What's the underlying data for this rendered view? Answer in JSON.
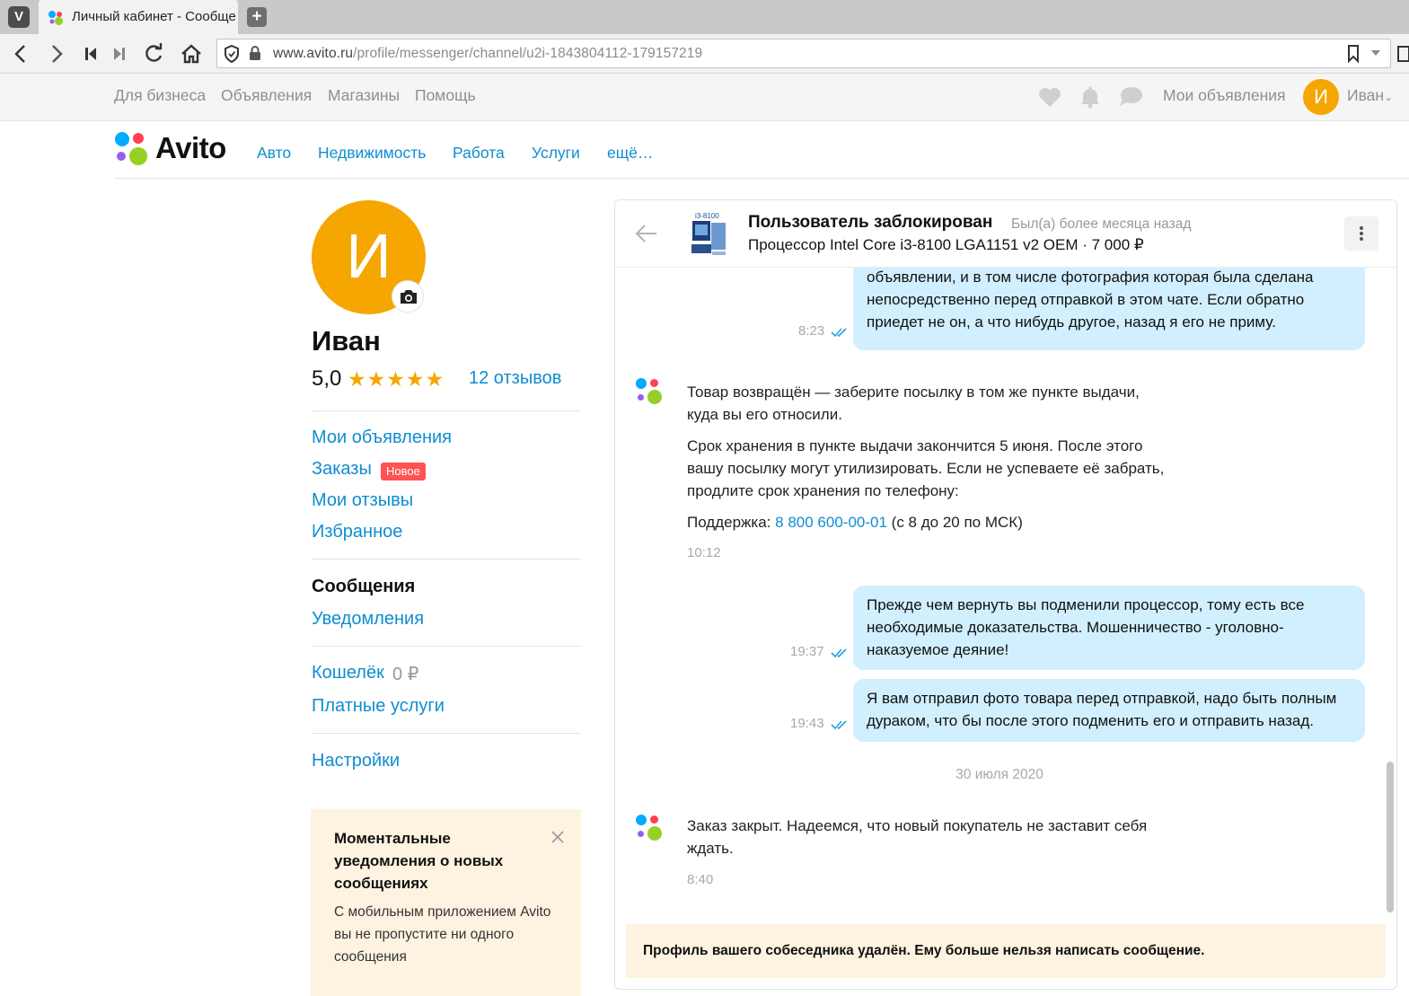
{
  "browser": {
    "tab_title": "Личный кабинет - Сообще",
    "url_domain": "www.avito.ru",
    "url_path": "/profile/messenger/channel/u2i-1843804112-179157219"
  },
  "topbar": {
    "links": [
      "Для бизнеса",
      "Объявления",
      "Магазины",
      "Помощь"
    ],
    "my_ads": "Мои объявления",
    "avatar_letter": "И",
    "username": "Иван"
  },
  "header": {
    "logo_text": "Avito",
    "categories": [
      "Авто",
      "Недвижимость",
      "Работа",
      "Услуги",
      "ещё…"
    ]
  },
  "profile": {
    "avatar_letter": "И",
    "name": "Иван",
    "rating": "5,0",
    "stars": 5,
    "reviews": "12 отзывов",
    "menu": {
      "my_ads": "Мои объявления",
      "orders": "Заказы",
      "orders_badge": "Новое",
      "my_reviews": "Мои отзывы",
      "favorites": "Избранное",
      "messages": "Сообщения",
      "notifications": "Уведомления",
      "wallet": "Кошелёк",
      "wallet_amount": "0 ₽",
      "paid_services": "Платные услуги",
      "settings": "Настройки"
    },
    "promo": {
      "title": "Моментальные уведомления о новых сообщениях",
      "text": "С мобильным приложением Avito вы не пропустите ни одного сообщения"
    }
  },
  "chat": {
    "user_status": "Пользователь заблокирован",
    "last_seen": "Был(а) более месяца назад",
    "item": "Процессор Intel Core i3-8100 LGA1151 v2 OEM · 7 000 ₽",
    "thumb_label": "i3-8100",
    "messages": [
      {
        "lines": [
          "объявлении, и в том числе фотография которая была сделана",
          "непосредственно перед отправкой в этом чате. Если обратно",
          "приедет не он, а что нибудь другое, назад я его не приму."
        ],
        "time": "8:23"
      },
      {
        "para1": [
          "Товар возвращён — заберите посылку в том же пункте выдачи,",
          "куда вы его относили."
        ],
        "para2": [
          "Срок хранения в пункте выдачи закончится 5 июня. После этого",
          "вашу посылку могут утилизировать. Если не успеваете её забрать,",
          "продлите срок хранения по телефону:"
        ],
        "support_label": "Поддержка:",
        "support_phone": "8 800 600-00-01",
        "support_hours": "(с 8 до 20 по МСК)",
        "time": "10:12"
      },
      {
        "lines": [
          "Прежде чем вернуть вы подменили процессор, тому есть все",
          "необходимые доказательства. Мошенничество - уголовно-",
          "наказуемое деяние!"
        ],
        "time": "19:37"
      },
      {
        "lines": [
          "Я вам отправил фото товара перед отправкой, надо быть полным",
          "дураком, что бы после этого подменить его и отправить назад."
        ],
        "time": "19:43"
      },
      {
        "lines": [
          "Заказ закрыт. Надеемся, что новый покупатель не заставит себя",
          "ждать."
        ],
        "time": "8:40"
      }
    ],
    "date_separator": "30 июля 2020",
    "blocked_notice": "Профиль вашего собеседника удалён. Ему больше нельзя написать сообщение."
  },
  "colors": {
    "accent_link": "#0f8dd1",
    "avatar": "#f6a600",
    "bubble": "#d2efff",
    "badge": "#ff5252",
    "promo_bg": "#fef3e1"
  },
  "icons": [
    "vivaldi-icon",
    "new-tab-icon",
    "back-icon",
    "forward-icon",
    "first-icon",
    "last-icon",
    "reload-icon",
    "home-icon",
    "shield-icon",
    "lock-icon",
    "bookmark-icon",
    "heart-icon",
    "bell-icon",
    "chat-bubble-icon",
    "camera-icon",
    "star-icon",
    "close-icon",
    "arrow-left-icon",
    "more-vertical-icon",
    "double-check-icon",
    "avito-logo-icon"
  ]
}
